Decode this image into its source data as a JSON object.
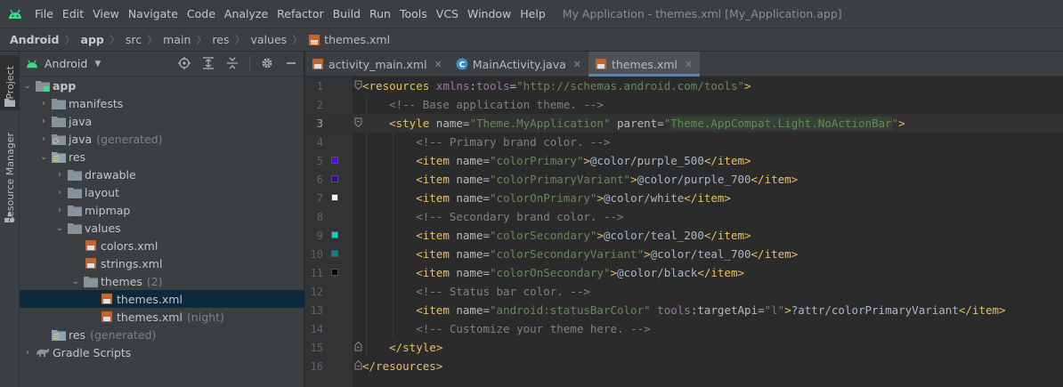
{
  "menubar": {
    "items": [
      "File",
      "Edit",
      "View",
      "Navigate",
      "Code",
      "Analyze",
      "Refactor",
      "Build",
      "Run",
      "Tools",
      "VCS",
      "Window",
      "Help"
    ],
    "window_title": "My Application - themes.xml [My_Application.app]"
  },
  "breadcrumb": [
    "Android",
    "app",
    "src",
    "main",
    "res",
    "values",
    "themes.xml"
  ],
  "toolstrip": {
    "project": "Project",
    "resource_manager": "Resource Manager"
  },
  "project_panel": {
    "view_selector": "Android",
    "tree": [
      {
        "label": "app",
        "extra": "",
        "depth": 0,
        "expanded": true,
        "icon": "module-icon"
      },
      {
        "label": "manifests",
        "extra": "",
        "depth": 1,
        "expanded": false,
        "icon": "folder-icon"
      },
      {
        "label": "java",
        "extra": "",
        "depth": 1,
        "expanded": false,
        "icon": "folder-icon"
      },
      {
        "label": "java",
        "extra": "(generated)",
        "depth": 1,
        "expanded": false,
        "icon": "generated-folder-icon"
      },
      {
        "label": "res",
        "extra": "",
        "depth": 1,
        "expanded": true,
        "icon": "res-folder-icon"
      },
      {
        "label": "drawable",
        "extra": "",
        "depth": 2,
        "expanded": false,
        "icon": "folder-icon"
      },
      {
        "label": "layout",
        "extra": "",
        "depth": 2,
        "expanded": false,
        "icon": "folder-icon"
      },
      {
        "label": "mipmap",
        "extra": "",
        "depth": 2,
        "expanded": false,
        "icon": "folder-icon"
      },
      {
        "label": "values",
        "extra": "",
        "depth": 2,
        "expanded": true,
        "icon": "folder-icon"
      },
      {
        "label": "colors.xml",
        "extra": "",
        "depth": 3,
        "leaf": true,
        "icon": "xml-file-icon"
      },
      {
        "label": "strings.xml",
        "extra": "",
        "depth": 3,
        "leaf": true,
        "icon": "xml-file-icon"
      },
      {
        "label": "themes",
        "extra": "(2)",
        "depth": 3,
        "expanded": true,
        "icon": "folder-icon"
      },
      {
        "label": "themes.xml",
        "extra": "",
        "depth": 4,
        "leaf": true,
        "icon": "xml-file-icon",
        "selected": true
      },
      {
        "label": "themes.xml",
        "extra": "(night)",
        "depth": 4,
        "leaf": true,
        "icon": "xml-file-icon"
      },
      {
        "label": "res",
        "extra": "(generated)",
        "depth": 1,
        "leaf": true,
        "icon": "res-folder-icon"
      },
      {
        "label": "Gradle Scripts",
        "extra": "",
        "depth": 0,
        "expanded": false,
        "icon": "gradle-icon"
      }
    ]
  },
  "tabs": [
    {
      "label": "activity_main.xml",
      "icon": "xml-file-icon",
      "active": false
    },
    {
      "label": "MainActivity.java",
      "icon": "java-class-icon",
      "active": false
    },
    {
      "label": "themes.xml",
      "icon": "xml-file-icon",
      "active": true
    }
  ],
  "editor": {
    "current_line": 3,
    "lines": [
      {
        "n": "1",
        "indent": 0,
        "fold": "open",
        "parts": [
          [
            "tag",
            "<resources "
          ],
          [
            "ns",
            "xmlns"
          ],
          [
            "attr",
            ":"
          ],
          [
            "ns",
            "tools"
          ],
          [
            "attr",
            "="
          ],
          [
            "str",
            "\"http://schemas.android.com/tools\""
          ],
          [
            "tag",
            ">"
          ]
        ]
      },
      {
        "n": "2",
        "indent": 1,
        "parts": [
          [
            "cmt",
            "<!-- Base application theme. -->"
          ]
        ]
      },
      {
        "n": "3",
        "indent": 1,
        "fold": "open",
        "parts": [
          [
            "tag",
            "<style "
          ],
          [
            "attr",
            "name"
          ],
          [
            "txt",
            "="
          ],
          [
            "str",
            "\"Theme.MyApplication\""
          ],
          [
            "txt",
            " "
          ],
          [
            "attr",
            "parent"
          ],
          [
            "txt",
            "="
          ],
          [
            "str",
            "\""
          ],
          [
            "hl",
            "Theme.AppCompat.Light.NoActionBar"
          ],
          [
            "str",
            "\""
          ],
          [
            "tag",
            ">"
          ]
        ]
      },
      {
        "n": "4",
        "indent": 2,
        "parts": [
          [
            "cmt",
            "<!-- Primary brand color. -->"
          ]
        ]
      },
      {
        "n": "5",
        "indent": 2,
        "swatch": "#6200ee",
        "parts": [
          [
            "tag",
            "<item "
          ],
          [
            "attr",
            "name"
          ],
          [
            "txt",
            "="
          ],
          [
            "str",
            "\"colorPrimary\""
          ],
          [
            "tag",
            ">"
          ],
          [
            "txt",
            "@color/purple_500"
          ],
          [
            "tag",
            "</item>"
          ]
        ]
      },
      {
        "n": "6",
        "indent": 2,
        "swatch": "#3700b3",
        "parts": [
          [
            "tag",
            "<item "
          ],
          [
            "attr",
            "name"
          ],
          [
            "txt",
            "="
          ],
          [
            "str",
            "\"colorPrimaryVariant\""
          ],
          [
            "tag",
            ">"
          ],
          [
            "txt",
            "@color/purple_700"
          ],
          [
            "tag",
            "</item>"
          ]
        ]
      },
      {
        "n": "7",
        "indent": 2,
        "swatch": "#ffffff",
        "parts": [
          [
            "tag",
            "<item "
          ],
          [
            "attr",
            "name"
          ],
          [
            "txt",
            "="
          ],
          [
            "str",
            "\"colorOnPrimary\""
          ],
          [
            "tag",
            ">"
          ],
          [
            "txt",
            "@color/white"
          ],
          [
            "tag",
            "</item>"
          ]
        ]
      },
      {
        "n": "8",
        "indent": 2,
        "parts": [
          [
            "cmt",
            "<!-- Secondary brand color. -->"
          ]
        ]
      },
      {
        "n": "9",
        "indent": 2,
        "swatch": "#03dac5",
        "parts": [
          [
            "tag",
            "<item "
          ],
          [
            "attr",
            "name"
          ],
          [
            "txt",
            "="
          ],
          [
            "str",
            "\"colorSecondary\""
          ],
          [
            "tag",
            ">"
          ],
          [
            "txt",
            "@color/teal_200"
          ],
          [
            "tag",
            "</item>"
          ]
        ]
      },
      {
        "n": "10",
        "indent": 2,
        "swatch": "#018786",
        "parts": [
          [
            "tag",
            "<item "
          ],
          [
            "attr",
            "name"
          ],
          [
            "txt",
            "="
          ],
          [
            "str",
            "\"colorSecondaryVariant\""
          ],
          [
            "tag",
            ">"
          ],
          [
            "txt",
            "@color/teal_700"
          ],
          [
            "tag",
            "</item>"
          ]
        ]
      },
      {
        "n": "11",
        "indent": 2,
        "swatch": "#000000",
        "parts": [
          [
            "tag",
            "<item "
          ],
          [
            "attr",
            "name"
          ],
          [
            "txt",
            "="
          ],
          [
            "str",
            "\"colorOnSecondary\""
          ],
          [
            "tag",
            ">"
          ],
          [
            "txt",
            "@color/black"
          ],
          [
            "tag",
            "</item>"
          ]
        ]
      },
      {
        "n": "12",
        "indent": 2,
        "parts": [
          [
            "cmt",
            "<!-- Status bar color. -->"
          ]
        ]
      },
      {
        "n": "13",
        "indent": 2,
        "parts": [
          [
            "tag",
            "<item "
          ],
          [
            "attr",
            "name"
          ],
          [
            "txt",
            "="
          ],
          [
            "str",
            "\"android:statusBarColor\""
          ],
          [
            "txt",
            " "
          ],
          [
            "ns",
            "tools"
          ],
          [
            "attr",
            ":targetApi"
          ],
          [
            "txt",
            "="
          ],
          [
            "str",
            "\"l\""
          ],
          [
            "tag",
            ">"
          ],
          [
            "txt",
            "?attr/colorPrimaryVariant"
          ],
          [
            "tag",
            "</item>"
          ]
        ]
      },
      {
        "n": "14",
        "indent": 2,
        "parts": [
          [
            "cmt",
            "<!-- Customize your theme here. -->"
          ]
        ]
      },
      {
        "n": "15",
        "indent": 1,
        "fold": "close",
        "parts": [
          [
            "tag",
            "</style>"
          ]
        ]
      },
      {
        "n": "16",
        "indent": 0,
        "fold": "close",
        "parts": [
          [
            "tag",
            "</resources>"
          ]
        ]
      }
    ]
  },
  "colors": {
    "android_green": "#3ddc84",
    "folder": "#87939a",
    "res_folder": "#8fa4b5",
    "xml_icon": "#c4652e",
    "java_icon": "#3a8fc7",
    "selection": "#0d293e",
    "tab_underline": "#4a88c7"
  }
}
